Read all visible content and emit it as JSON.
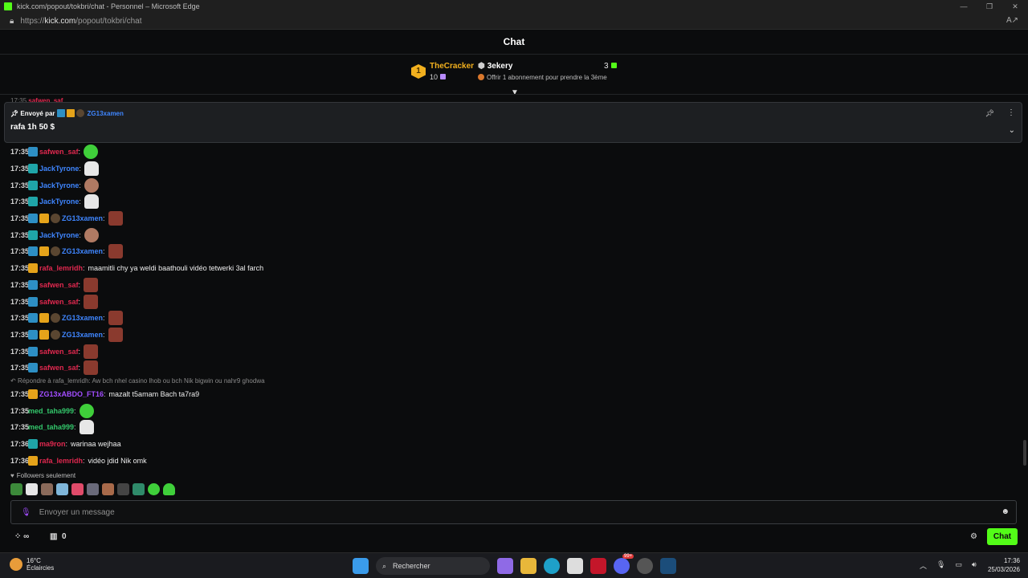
{
  "browser": {
    "window_title": "kick.com/popout/tokbri/chat - Personnel – Microsoft Edge",
    "url_prefix": "https://",
    "url_host": "kick.com",
    "url_path": "/popout/tokbri/chat"
  },
  "header": {
    "title": "Chat"
  },
  "leaderboard": {
    "rank": "1",
    "top_gifter": "TheCracker",
    "top_gifter_count": "10",
    "subs_user": "3ekery",
    "subs_count": "3",
    "offer_text": "Offrir 1 abonnement pour prendre la 3ème"
  },
  "peek_row": {
    "time": "17:35",
    "user": "safwen_saf"
  },
  "pinned": {
    "sent_by_label": "Envoyé par",
    "sender": "ZG13xamen",
    "message": "rafa 1h 50 $"
  },
  "messages": [
    {
      "time": "17:35",
      "badges": [
        "og"
      ],
      "user": "safwen_saf",
      "color": "red",
      "text": "",
      "emote": "green"
    },
    {
      "time": "17:35",
      "badges": [
        "sub"
      ],
      "user": "JackTyrone",
      "color": "blue",
      "text": "",
      "emote": "white"
    },
    {
      "time": "17:35",
      "badges": [
        "sub"
      ],
      "user": "JackTyrone",
      "color": "blue",
      "text": "",
      "emote": "face"
    },
    {
      "time": "17:35",
      "badges": [
        "sub"
      ],
      "user": "JackTyrone",
      "color": "blue",
      "text": "",
      "emote": "white"
    },
    {
      "time": "17:35",
      "badges": [
        "og",
        "crown",
        "mod"
      ],
      "user": "ZG13xamen",
      "color": "blue",
      "text": "",
      "emote": "red"
    },
    {
      "time": "17:35",
      "badges": [
        "sub"
      ],
      "user": "JackTyrone",
      "color": "blue",
      "text": "",
      "emote": "face"
    },
    {
      "time": "17:35",
      "badges": [
        "og",
        "crown",
        "mod"
      ],
      "user": "ZG13xamen",
      "color": "blue",
      "text": "",
      "emote": "red"
    },
    {
      "time": "17:35",
      "badges": [
        "crown"
      ],
      "user": "rafa_lemridh",
      "color": "red",
      "text": "maamitli chy ya weldi baathouli vidéo tetwerki 3al farch",
      "emote": ""
    },
    {
      "time": "17:35",
      "badges": [
        "og"
      ],
      "user": "safwen_saf",
      "color": "red",
      "text": "",
      "emote": "red"
    },
    {
      "time": "17:35",
      "badges": [
        "og"
      ],
      "user": "safwen_saf",
      "color": "red",
      "text": "",
      "emote": "red"
    },
    {
      "time": "17:35",
      "badges": [
        "og",
        "crown",
        "mod"
      ],
      "user": "ZG13xamen",
      "color": "blue",
      "text": "",
      "emote": "red"
    },
    {
      "time": "17:35",
      "badges": [
        "og",
        "crown",
        "mod"
      ],
      "user": "ZG13xamen",
      "color": "blue",
      "text": "",
      "emote": "red"
    },
    {
      "time": "17:35",
      "badges": [
        "og"
      ],
      "user": "safwen_saf",
      "color": "red",
      "text": "",
      "emote": "red"
    },
    {
      "time": "17:35",
      "badges": [
        "og"
      ],
      "user": "safwen_saf",
      "color": "red",
      "text": "",
      "emote": "red"
    }
  ],
  "reply_context": "Répondre à rafa_lemridh: Aw bch nhel casino lhob ou bch Nik bigwin ou nahr9 ghodwa",
  "messages2": [
    {
      "time": "17:35",
      "badges": [
        "crown"
      ],
      "user": "ZG13xABDO_FT16",
      "color": "purple",
      "text": "mazalt t5amam Bach ta7ra9",
      "emote": ""
    },
    {
      "time": "17:35",
      "badges": [],
      "user": "med_taha999",
      "color": "green",
      "text": "",
      "emote": "green"
    },
    {
      "time": "17:35",
      "badges": [],
      "user": "med_taha999",
      "color": "green",
      "text": "",
      "emote": "white"
    },
    {
      "time": "17:36",
      "badges": [
        "sub"
      ],
      "user": "ma9ron",
      "color": "red",
      "text": "warinaa wejhaa",
      "emote": ""
    },
    {
      "time": "17:36",
      "badges": [
        "crown"
      ],
      "user": "rafa_lemridh",
      "color": "red",
      "text": "vidéo jdid Nik omk",
      "emote": ""
    }
  ],
  "followers_label": "Followers seulement",
  "input": {
    "placeholder": "Envoyer un message"
  },
  "bottom": {
    "left_value": "∞",
    "points": "0",
    "chat_button": "Chat"
  },
  "taskbar": {
    "temperature": "16°C",
    "weather": "Éclaircies",
    "search_label": "Rechercher",
    "time": "17:36",
    "date": "25/03/2026",
    "badge_count": "99+"
  },
  "colors": {
    "accent": "#53fc18",
    "user_red": "#e0284f",
    "user_blue": "#3f86ff",
    "user_green": "#33c76b",
    "user_purple": "#a24dff"
  }
}
